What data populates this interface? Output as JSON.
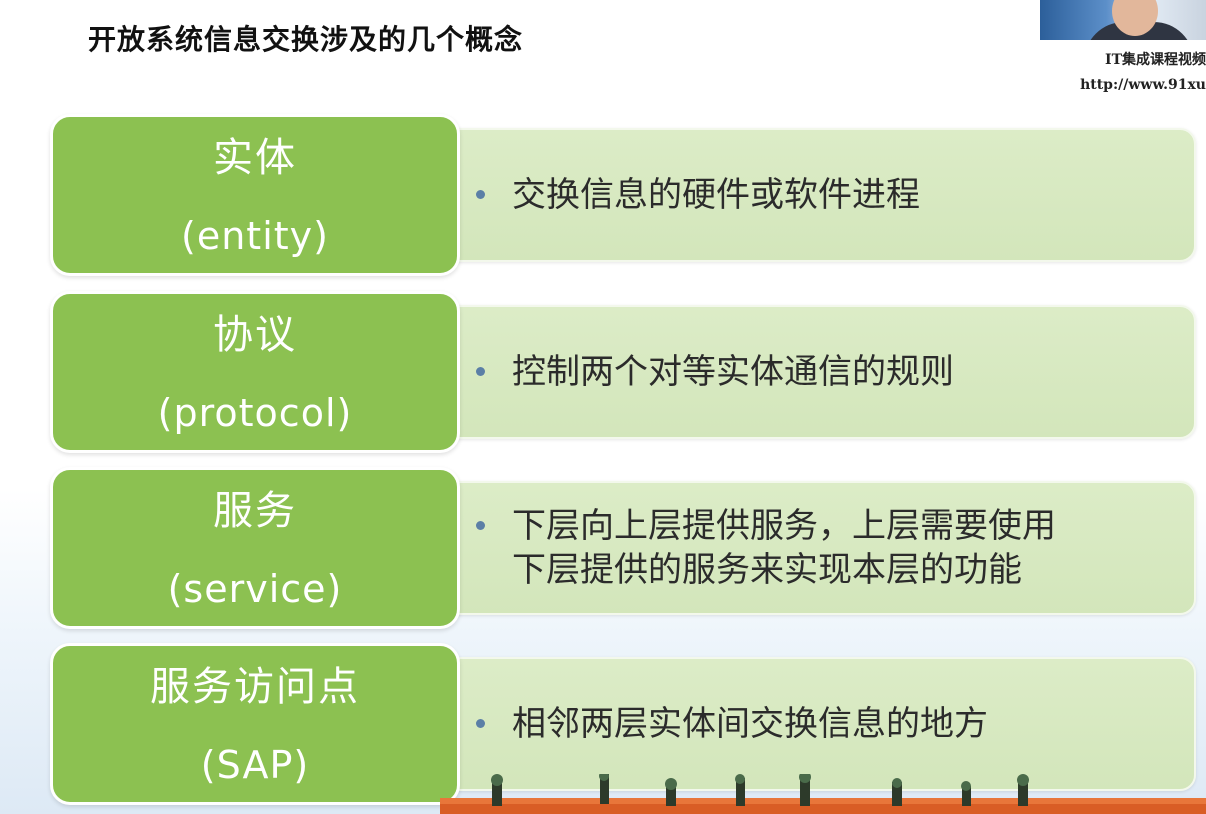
{
  "page": {
    "title": "开放系统信息交换涉及的几个概念"
  },
  "watermark": {
    "line1": "IT集成课程视频",
    "line2": "http://www.91xu"
  },
  "concepts": [
    {
      "term_cn": "实体",
      "term_en": "(entity)",
      "lines": [
        "交换信息的硬件或软件进程"
      ]
    },
    {
      "term_cn": "协议",
      "term_en": "(protocol)",
      "lines": [
        "控制两个对等实体通信的规则"
      ]
    },
    {
      "term_cn": "服务",
      "term_en": "(service)",
      "lines": [
        "下层向上层提供服务，上层需要使用",
        "下层提供的服务来实现本层的功能"
      ]
    },
    {
      "term_cn": "服务访问点",
      "term_en": "(SAP)",
      "lines": [
        "相邻两层实体间交换信息的地方"
      ]
    }
  ],
  "colors": {
    "term_box": "#8cc151",
    "desc_box": "#d8e9c2",
    "bullet": "#5b7fa6"
  },
  "icons": {
    "bullet": "bullet-dot-icon"
  }
}
